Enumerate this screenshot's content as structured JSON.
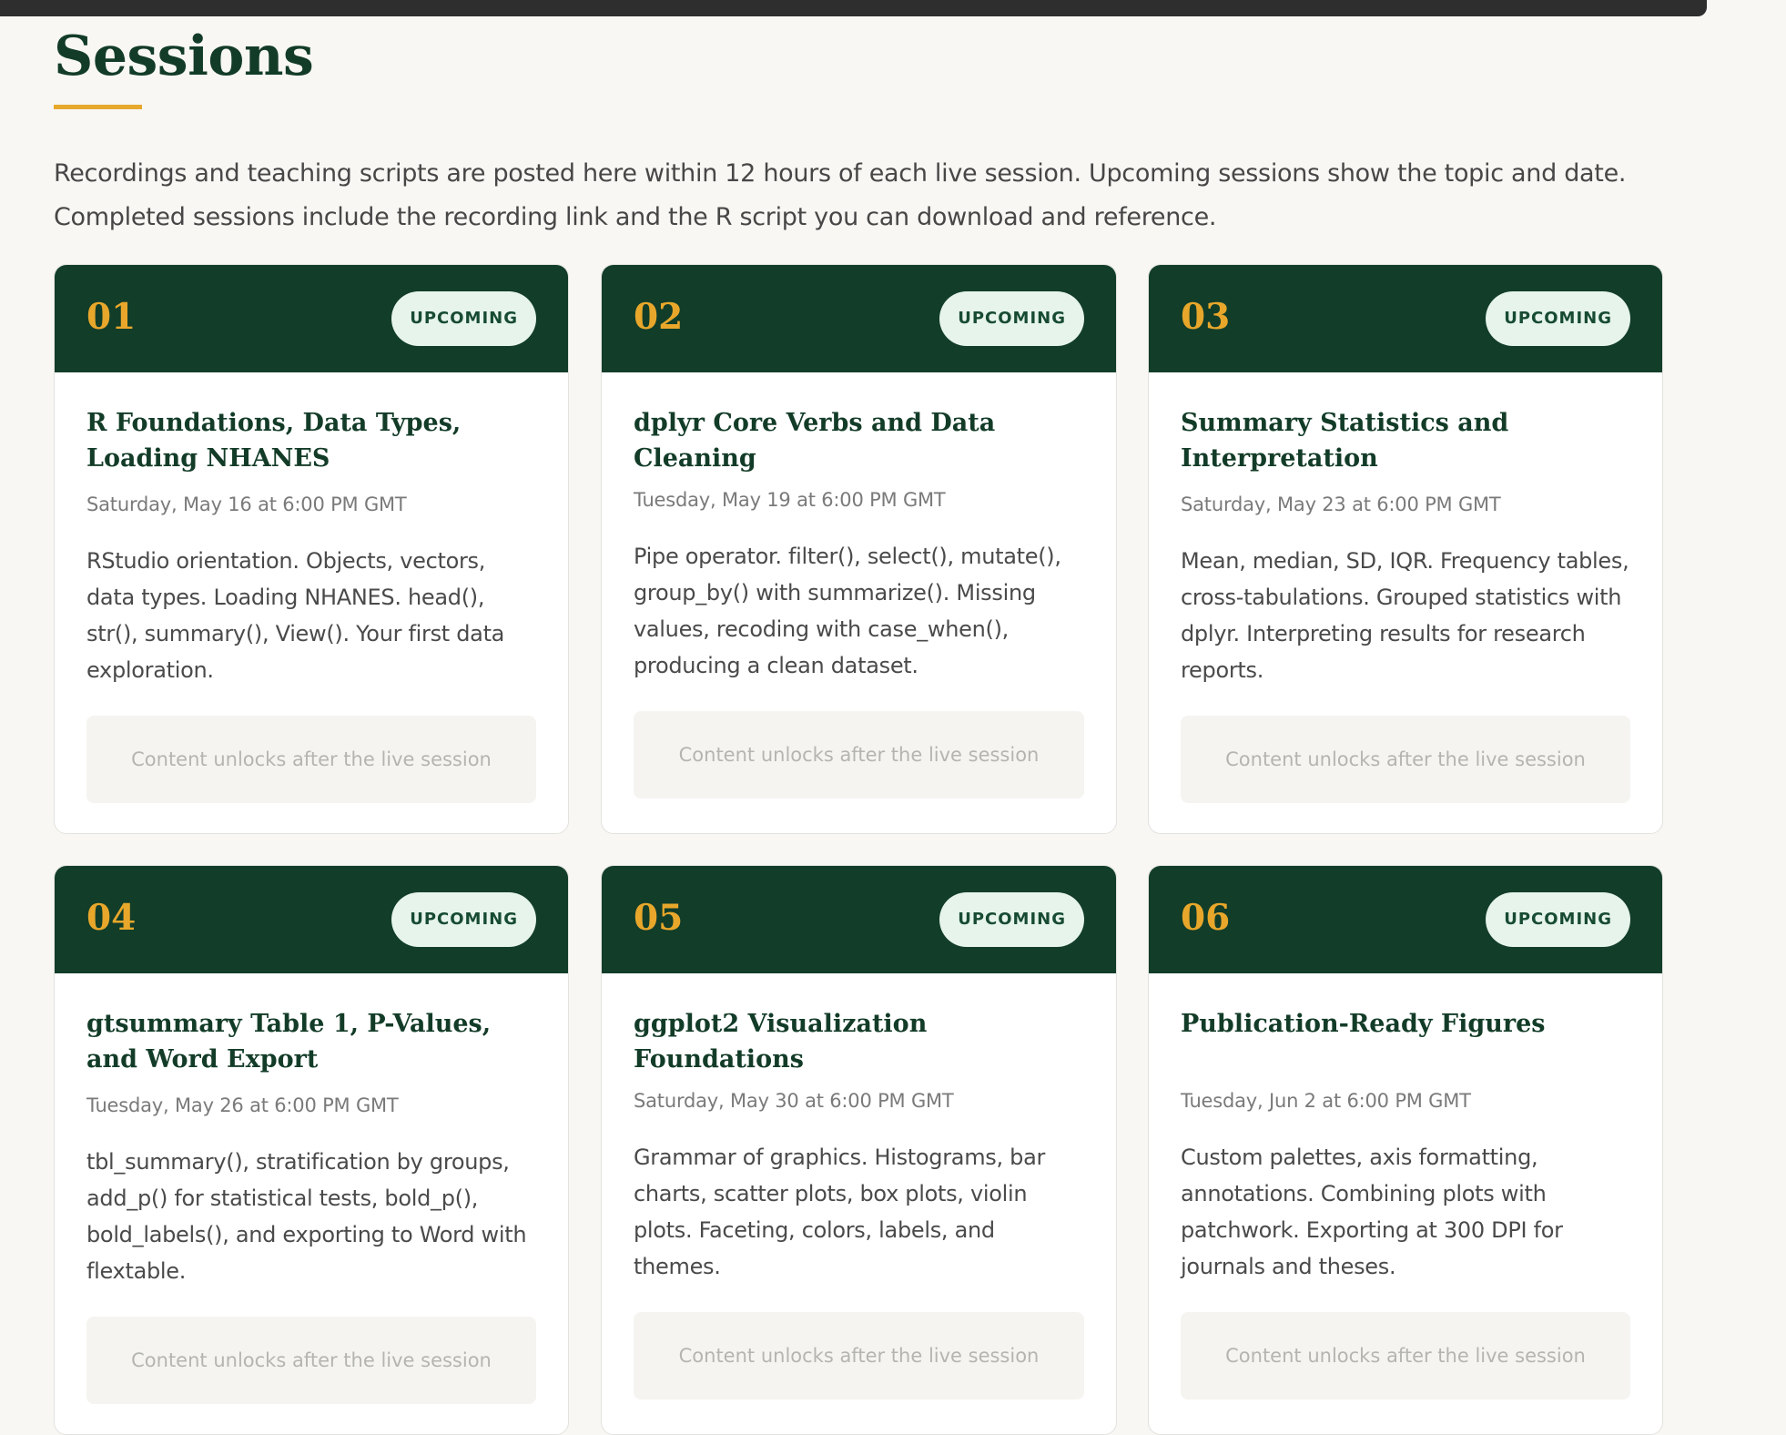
{
  "page": {
    "title": "Sessions",
    "intro": "Recordings and teaching scripts are posted here within 12 hours of each live session. Upcoming sessions show the topic and date. Completed sessions include the recording link and the R script you can download and reference."
  },
  "colors": {
    "header_green": "#123d29",
    "accent_gold": "#e8a72b",
    "badge_bg": "#e6f4ec",
    "title_green": "#133c28"
  },
  "sessions": [
    {
      "number": "01",
      "status": "UPCOMING",
      "title": "R Foundations, Data Types, Loading NHANES",
      "date": "Saturday, May 16 at 6:00 PM GMT",
      "description": "RStudio orientation. Objects, vectors, data types. Loading NHANES. head(), str(), summary(), View(). Your first data exploration.",
      "locked_text": "Content unlocks after the live session"
    },
    {
      "number": "02",
      "status": "UPCOMING",
      "title": "dplyr Core Verbs and Data Cleaning",
      "date": "Tuesday, May 19 at 6:00 PM GMT",
      "description": "Pipe operator. filter(), select(), mutate(), group_by() with summarize(). Missing values, recoding with case_when(), producing a clean dataset.",
      "locked_text": "Content unlocks after the live session"
    },
    {
      "number": "03",
      "status": "UPCOMING",
      "title": "Summary Statistics and Interpretation",
      "date": "Saturday, May 23 at 6:00 PM GMT",
      "description": "Mean, median, SD, IQR. Frequency tables, cross-tabulations. Grouped statistics with dplyr. Interpreting results for research reports.",
      "locked_text": "Content unlocks after the live session"
    },
    {
      "number": "04",
      "status": "UPCOMING",
      "title": "gtsummary Table 1, P-Values, and Word Export",
      "date": "Tuesday, May 26 at 6:00 PM GMT",
      "description": "tbl_summary(), stratification by groups, add_p() for statistical tests, bold_p(), bold_labels(), and exporting to Word with flextable.",
      "locked_text": "Content unlocks after the live session"
    },
    {
      "number": "05",
      "status": "UPCOMING",
      "title": "ggplot2 Visualization Foundations",
      "date": "Saturday, May 30 at 6:00 PM GMT",
      "description": "Grammar of graphics. Histograms, bar charts, scatter plots, box plots, violin plots. Faceting, colors, labels, and themes.",
      "locked_text": "Content unlocks after the live session"
    },
    {
      "number": "06",
      "status": "UPCOMING",
      "title": "Publication-Ready Figures",
      "date": "Tuesday, Jun 2 at 6:00 PM GMT",
      "description": "Custom palettes, axis formatting, annotations. Combining plots with patchwork. Exporting at 300 DPI for journals and theses.",
      "locked_text": "Content unlocks after the live session"
    }
  ]
}
